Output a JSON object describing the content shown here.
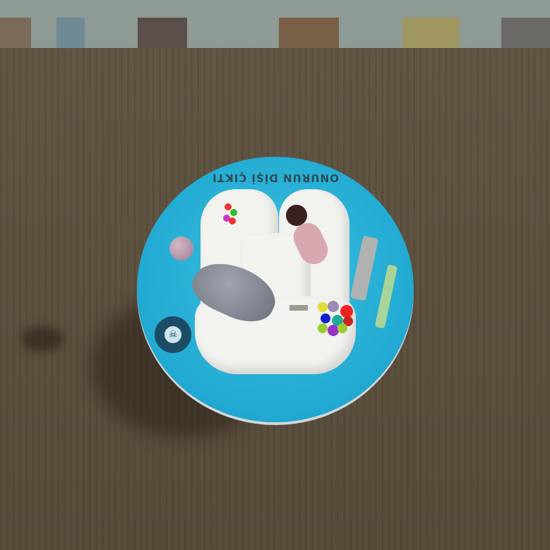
{
  "cake": {
    "inscription": "ONURUN DİŞİ ÇIKTI"
  },
  "colors": {
    "board": "#21a9d2",
    "icing": "#f2f2ee",
    "table": "#5a4e3c"
  }
}
